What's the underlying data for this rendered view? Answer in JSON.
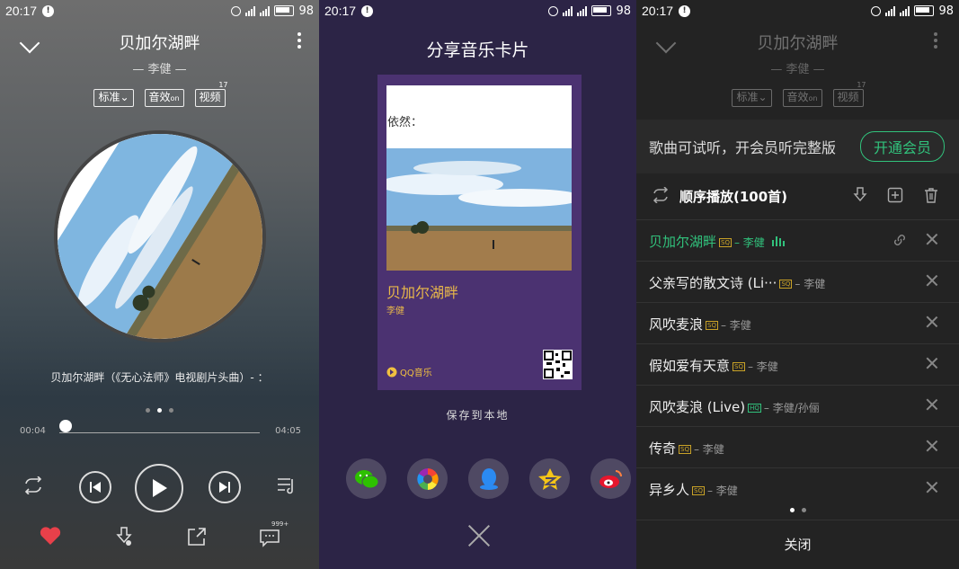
{
  "status": {
    "time": "20:17",
    "battery": "98"
  },
  "player": {
    "song_title": "贝加尔湖畔",
    "artist": "李健",
    "quality_label": "标准",
    "effect_label": "音效",
    "effect_state": "on",
    "video_label": "视频",
    "video_count": "17",
    "lyric": "贝加尔湖畔（《无心法师》电视剧片头曲）- ：",
    "time_current": "00:04",
    "time_total": "04:05",
    "progress_fraction": 0.03,
    "comments_badge": "999+",
    "like_color": "#e8404a"
  },
  "share": {
    "title": "分享音乐卡片",
    "card_photo_caption": "依然：",
    "card_song": "贝加尔湖畔",
    "card_artist": "李健",
    "card_brand": "QQ音乐",
    "save_label": "保存到本地",
    "targets": [
      "wechat-icon",
      "moments-icon",
      "qq-icon",
      "qzone-icon",
      "weibo-icon"
    ]
  },
  "playlist": {
    "promo_text": "歌曲可试听，开会员听完整版",
    "vip_button": "开通会员",
    "mode_label": "顺序播放(100首)",
    "accent": "#31c27c",
    "songs": [
      {
        "name": "贝加尔湖畔",
        "tag": "SQ",
        "artist": "李健"
      },
      {
        "name": "父亲写的散文诗 (Li···",
        "tag": "SQ",
        "artist": "李健"
      },
      {
        "name": "风吹麦浪",
        "tag": "SQ",
        "artist": "李健"
      },
      {
        "name": "假如爱有天意",
        "tag": "SQ",
        "artist": "李健"
      },
      {
        "name": "风吹麦浪 (Live)",
        "tag": "HQ",
        "artist": "李健/孙俪"
      },
      {
        "name": "传奇",
        "tag": "SQ",
        "artist": "李健"
      },
      {
        "name": "异乡人",
        "tag": "SQ",
        "artist": "李健"
      }
    ],
    "close_label": "关闭"
  }
}
